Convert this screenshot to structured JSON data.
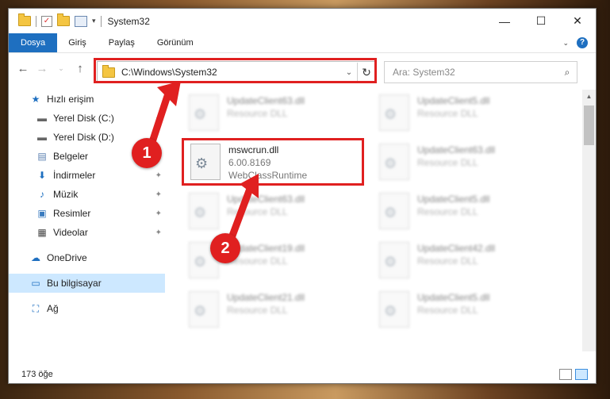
{
  "window": {
    "title": "System32"
  },
  "ribbon": {
    "tabs": [
      "Dosya",
      "Giriş",
      "Paylaş",
      "Görünüm"
    ]
  },
  "address": {
    "path": "C:\\Windows\\System32"
  },
  "search": {
    "placeholder": "Ara: System32"
  },
  "sidebar": {
    "items": [
      {
        "label": "Hızlı erişim",
        "icon": "star-icon",
        "pinned": false
      },
      {
        "label": "Yerel Disk (C:)",
        "icon": "drive-icon",
        "pinned": true
      },
      {
        "label": "Yerel Disk (D:)",
        "icon": "drive-icon",
        "pinned": false
      },
      {
        "label": "Belgeler",
        "icon": "documents-icon",
        "pinned": true
      },
      {
        "label": "İndirmeler",
        "icon": "download-icon",
        "pinned": true
      },
      {
        "label": "Müzik",
        "icon": "music-icon",
        "pinned": true
      },
      {
        "label": "Resimler",
        "icon": "pictures-icon",
        "pinned": true
      },
      {
        "label": "Videolar",
        "icon": "videos-icon",
        "pinned": true
      },
      {
        "label": "OneDrive",
        "icon": "cloud-icon",
        "pinned": false
      },
      {
        "label": "Bu bilgisayar",
        "icon": "computer-icon",
        "pinned": false,
        "selected": true
      },
      {
        "label": "Ağ",
        "icon": "network-icon",
        "pinned": false
      }
    ]
  },
  "files": [
    {
      "name": "UpdateClient63.dll",
      "line2": "Resource DLL",
      "blurred": true
    },
    {
      "name": "UpdateClient5.dll",
      "line2": "Resource DLL",
      "blurred": true
    },
    {
      "name": "mswcrun.dll",
      "line2": "6.00.8169",
      "line3": "WebClassRuntime",
      "blurred": false
    },
    {
      "name": "UpdateClient63.dll",
      "line2": "Resource DLL",
      "blurred": true
    },
    {
      "name": "UpdateClient63.dll",
      "line2": "Resource DLL",
      "blurred": true
    },
    {
      "name": "UpdateClient5.dll",
      "line2": "Resource DLL",
      "blurred": true
    },
    {
      "name": "UpdateClient19.dll",
      "line2": "Resource DLL",
      "blurred": true
    },
    {
      "name": "UpdateClient42.dll",
      "line2": "Resource DLL",
      "blurred": true
    },
    {
      "name": "UpdateClient21.dll",
      "line2": "Resource DLL",
      "blurred": true
    },
    {
      "name": "UpdateClient5.dll",
      "line2": "Resource DLL",
      "blurred": true
    }
  ],
  "status": {
    "count": "173 öğe"
  },
  "annotations": {
    "badge1": "1",
    "badge2": "2",
    "color": "#e02020"
  }
}
